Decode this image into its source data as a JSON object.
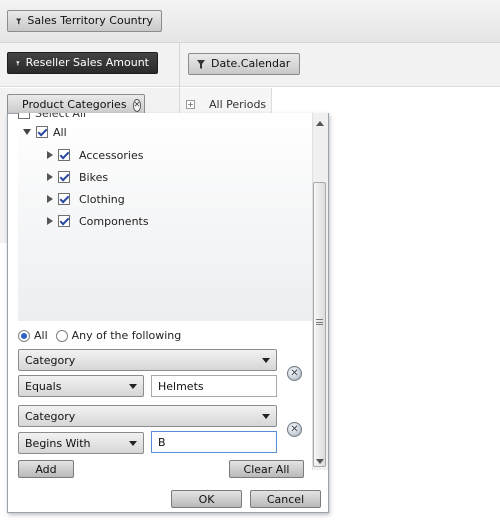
{
  "filter_areas": {
    "columns_field": {
      "label": "Sales Territory Country",
      "icon": "filter-icon"
    },
    "values_field": {
      "label": "Reseller Sales Amount",
      "icon": "filter-icon"
    },
    "date_field": {
      "label": "Date.Calendar",
      "icon": "filter-icon"
    },
    "rows_field": {
      "label": "Product Categories",
      "icon": "filter-icon",
      "close_icon": "close-circle-icon"
    }
  },
  "row_header": {
    "expand_symbol": "+",
    "label": "All Periods"
  },
  "filter_popup": {
    "partial_label": "Select All",
    "tree": [
      {
        "label": "All",
        "checked": true,
        "expanded": true,
        "level": 0
      },
      {
        "label": "Accessories",
        "checked": true,
        "expanded": false,
        "level": 1
      },
      {
        "label": "Bikes",
        "checked": true,
        "expanded": false,
        "level": 1
      },
      {
        "label": "Clothing",
        "checked": true,
        "expanded": false,
        "level": 1
      },
      {
        "label": "Components",
        "checked": true,
        "expanded": false,
        "level": 1
      }
    ],
    "match_mode": {
      "options": [
        "All",
        "Any of the following"
      ],
      "selected": "All"
    },
    "conditions": [
      {
        "field": "Category",
        "operator": "Equals",
        "value": "Helmets"
      },
      {
        "field": "Category",
        "operator": "Begins With",
        "value": "B"
      }
    ],
    "add_label": "Add",
    "clear_all_label": "Clear All",
    "ok_label": "OK",
    "cancel_label": "Cancel"
  }
}
